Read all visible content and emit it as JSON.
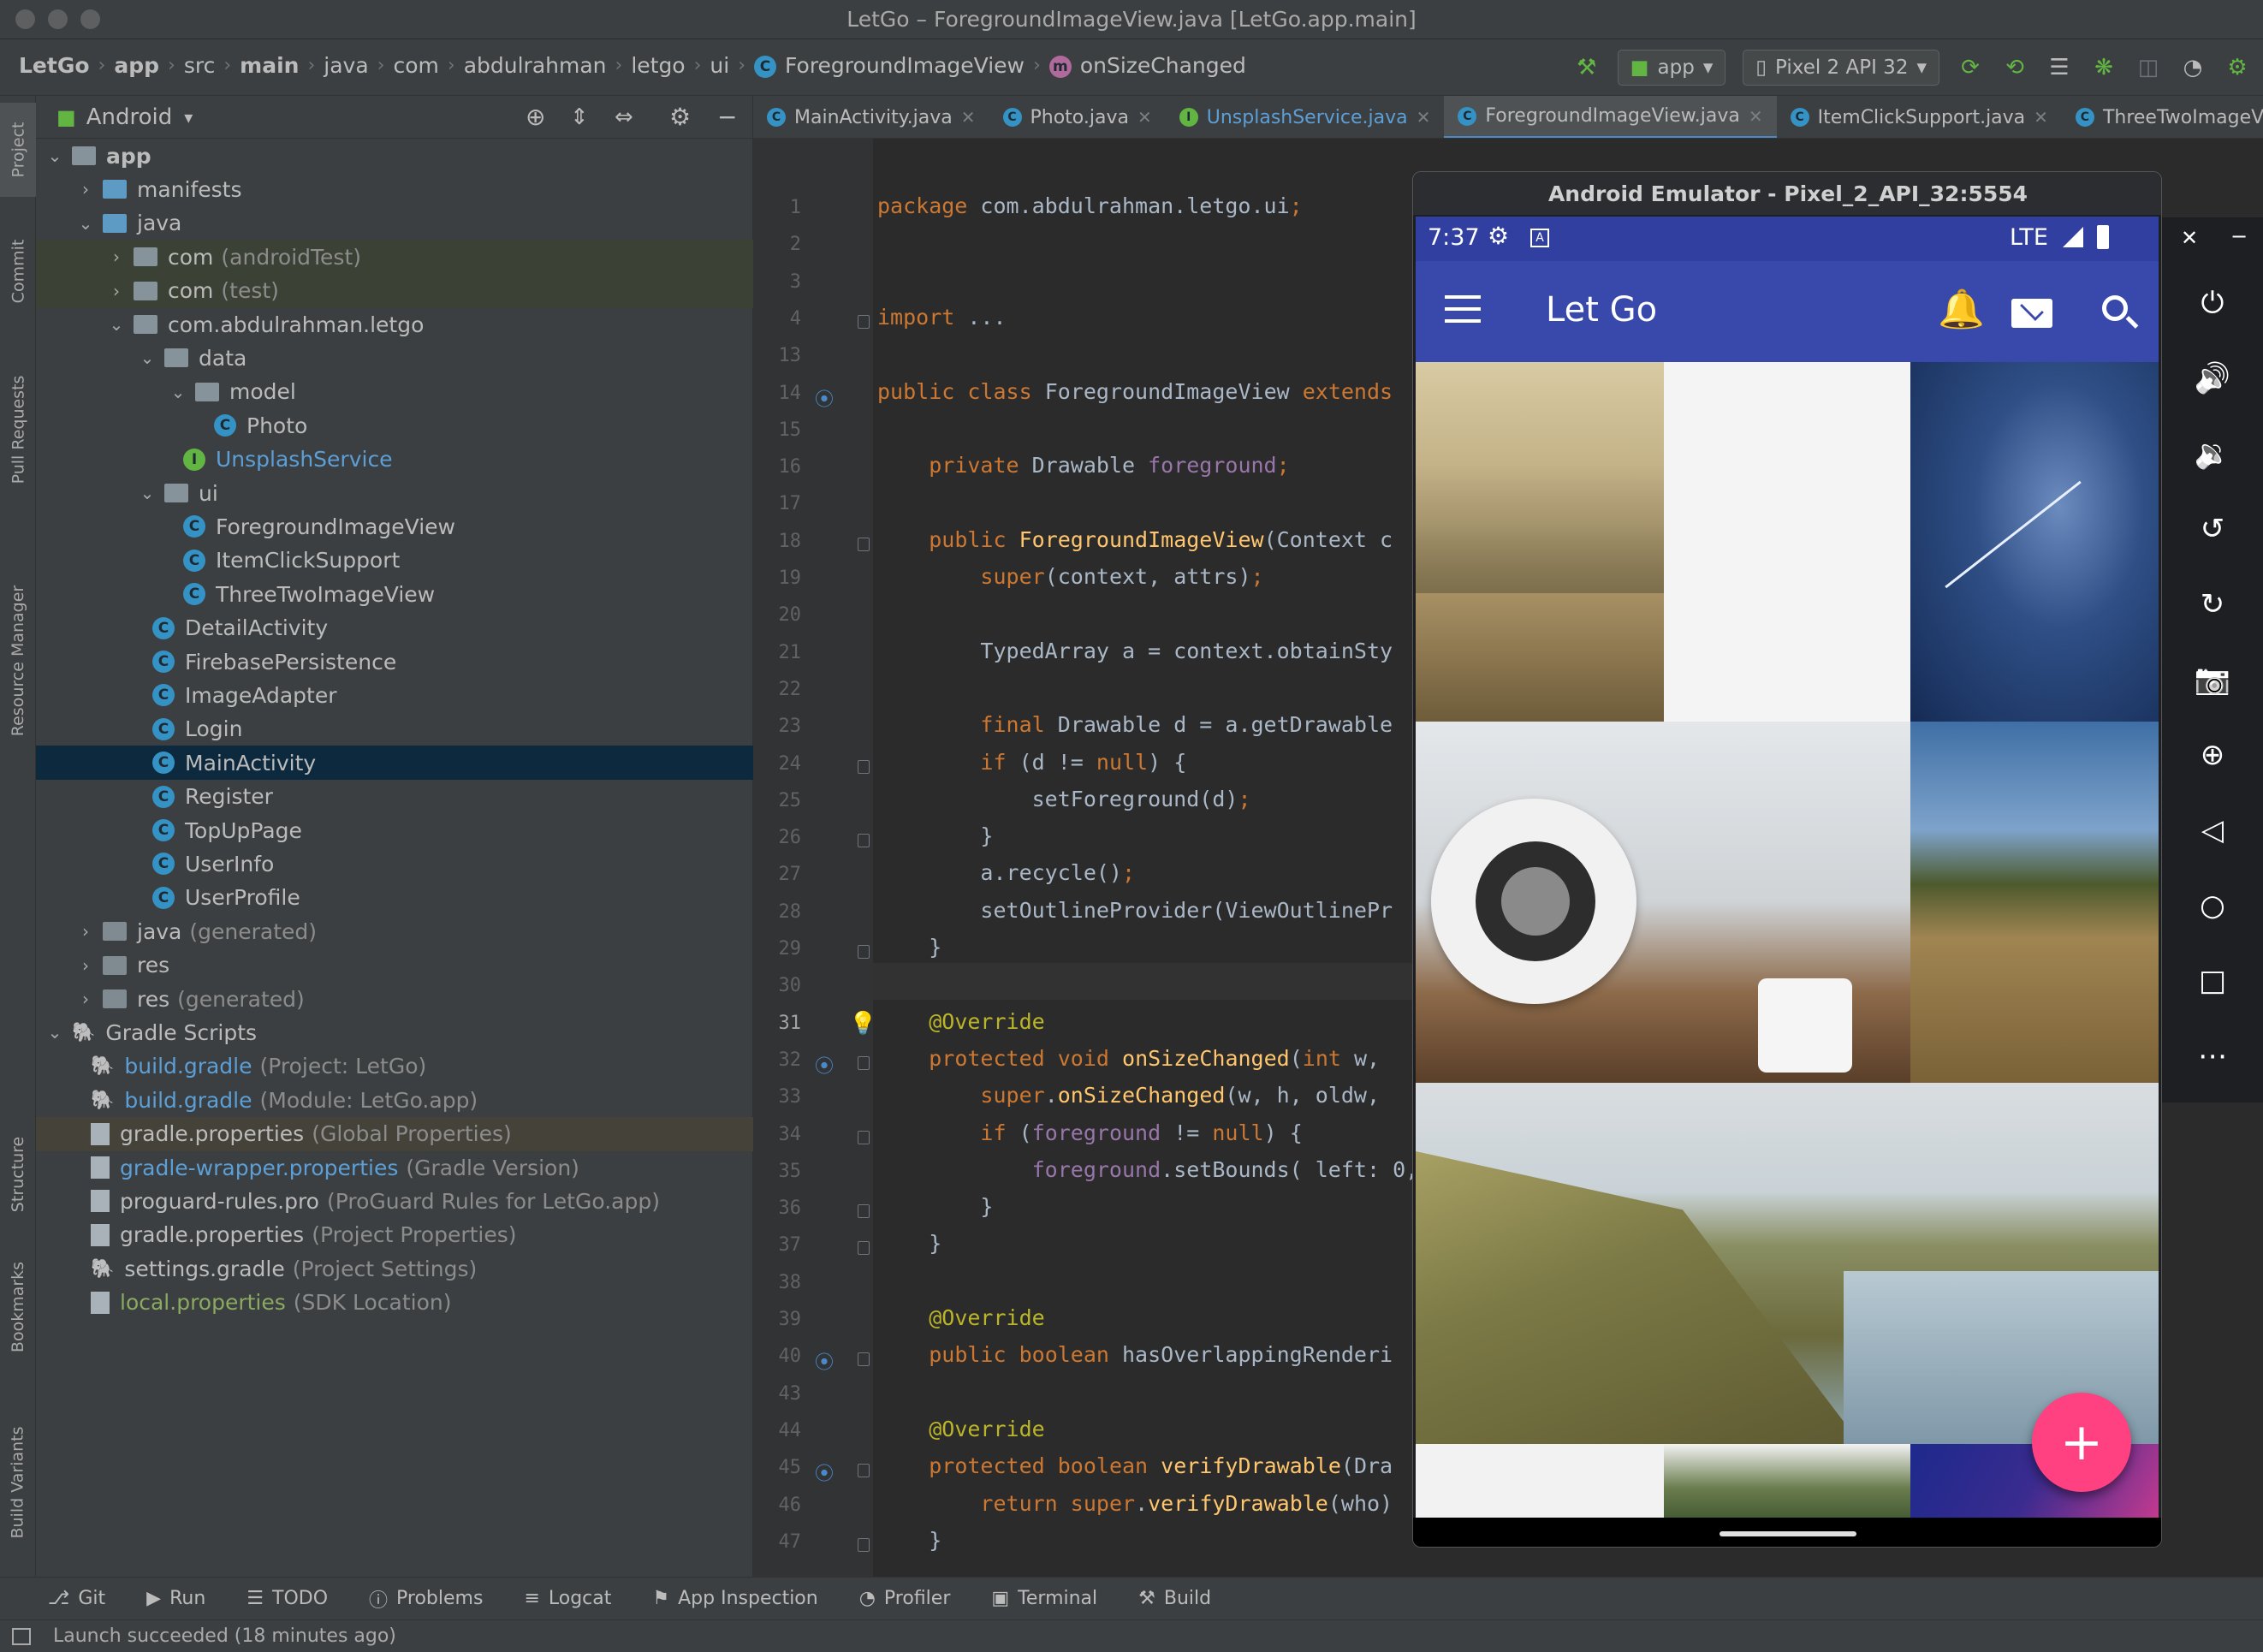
{
  "window": {
    "title": "LetGo – ForegroundImageView.java [LetGo.app.main]"
  },
  "breadcrumbs": [
    "LetGo",
    "app",
    "src",
    "main",
    "java",
    "com",
    "abdulrahman",
    "letgo",
    "ui",
    "ForegroundImageView",
    "onSizeChanged"
  ],
  "toolbar": {
    "run_config": "app",
    "device": "Pixel 2 API 32"
  },
  "left_tool_windows": [
    "Project",
    "Commit",
    "Pull Requests",
    "Resource Manager",
    "Structure",
    "Bookmarks",
    "Build Variants"
  ],
  "project_panel": {
    "view_mode": "Android",
    "tree": [
      {
        "label": "app",
        "extra": "",
        "depth": 0,
        "icon": "folder-app-icon",
        "expanded": true
      },
      {
        "label": "manifests",
        "extra": "",
        "depth": 1,
        "icon": "folder-icon",
        "expanded": false
      },
      {
        "label": "java",
        "extra": "",
        "depth": 1,
        "icon": "folder-icon",
        "expanded": true
      },
      {
        "label": "com",
        "extra": "(androidTest)",
        "depth": 2,
        "icon": "package-icon",
        "expanded": false
      },
      {
        "label": "com",
        "extra": "(test)",
        "depth": 2,
        "icon": "package-icon",
        "expanded": false
      },
      {
        "label": "com.abdulrahman.letgo",
        "extra": "",
        "depth": 2,
        "icon": "package-icon",
        "expanded": true
      },
      {
        "label": "data",
        "extra": "",
        "depth": 3,
        "icon": "package-icon",
        "expanded": true
      },
      {
        "label": "model",
        "extra": "",
        "depth": 4,
        "icon": "package-icon",
        "expanded": true
      },
      {
        "label": "Photo",
        "extra": "",
        "depth": 5,
        "icon": "class-icon"
      },
      {
        "label": "UnsplashService",
        "extra": "",
        "depth": 4,
        "icon": "interface-icon"
      },
      {
        "label": "ui",
        "extra": "",
        "depth": 3,
        "icon": "package-icon",
        "expanded": true
      },
      {
        "label": "ForegroundImageView",
        "extra": "",
        "depth": 4,
        "icon": "class-icon"
      },
      {
        "label": "ItemClickSupport",
        "extra": "",
        "depth": 4,
        "icon": "class-icon"
      },
      {
        "label": "ThreeTwoImageView",
        "extra": "",
        "depth": 4,
        "icon": "class-icon"
      },
      {
        "label": "DetailActivity",
        "extra": "",
        "depth": 3,
        "icon": "class-icon"
      },
      {
        "label": "FirebasePersistence",
        "extra": "",
        "depth": 3,
        "icon": "class-icon"
      },
      {
        "label": "ImageAdapter",
        "extra": "",
        "depth": 3,
        "icon": "class-icon"
      },
      {
        "label": "Login",
        "extra": "",
        "depth": 3,
        "icon": "class-icon"
      },
      {
        "label": "MainActivity",
        "extra": "",
        "depth": 3,
        "icon": "class-icon",
        "selected": true
      },
      {
        "label": "Register",
        "extra": "",
        "depth": 3,
        "icon": "class-icon"
      },
      {
        "label": "TopUpPage",
        "extra": "",
        "depth": 3,
        "icon": "class-icon"
      },
      {
        "label": "UserInfo",
        "extra": "",
        "depth": 3,
        "icon": "class-icon"
      },
      {
        "label": "UserProfile",
        "extra": "",
        "depth": 3,
        "icon": "class-icon"
      },
      {
        "label": "java",
        "extra": "(generated)",
        "depth": 1,
        "icon": "folder-generated-icon",
        "expanded": false
      },
      {
        "label": "res",
        "extra": "",
        "depth": 1,
        "icon": "folder-res-icon",
        "expanded": false
      },
      {
        "label": "res",
        "extra": "(generated)",
        "depth": 1,
        "icon": "folder-res-icon",
        "expanded": false
      },
      {
        "label": "Gradle Scripts",
        "extra": "",
        "depth": 0,
        "icon": "gradle-icon",
        "expanded": true
      },
      {
        "label": "build.gradle",
        "extra": "(Project: LetGo)",
        "depth": 1,
        "icon": "gradle-file-icon"
      },
      {
        "label": "build.gradle",
        "extra": "(Module: LetGo.app)",
        "depth": 1,
        "icon": "gradle-file-icon"
      },
      {
        "label": "gradle.properties",
        "extra": "(Global Properties)",
        "depth": 1,
        "icon": "properties-file-icon"
      },
      {
        "label": "gradle-wrapper.properties",
        "extra": "(Gradle Version)",
        "depth": 1,
        "icon": "properties-file-icon"
      },
      {
        "label": "proguard-rules.pro",
        "extra": "(ProGuard Rules for LetGo.app)",
        "depth": 1,
        "icon": "text-file-icon"
      },
      {
        "label": "gradle.properties",
        "extra": "(Project Properties)",
        "depth": 1,
        "icon": "properties-file-icon"
      },
      {
        "label": "settings.gradle",
        "extra": "(Project Settings)",
        "depth": 1,
        "icon": "gradle-file-icon"
      },
      {
        "label": "local.properties",
        "extra": "(SDK Location)",
        "depth": 1,
        "icon": "properties-file-icon"
      }
    ]
  },
  "editor_tabs": [
    {
      "label": "MainActivity.java",
      "icon": "class-icon"
    },
    {
      "label": "Photo.java",
      "icon": "class-icon"
    },
    {
      "label": "UnsplashService.java",
      "icon": "interface-icon"
    },
    {
      "label": "ForegroundImageView.java",
      "icon": "class-icon",
      "active": true
    },
    {
      "label": "ItemClickSupport.java",
      "icon": "class-icon"
    },
    {
      "label": "ThreeTwoImageView.j",
      "icon": "class-icon"
    }
  ],
  "code_lines": [
    {
      "n": "1",
      "text": "package com.abdulrahman.letgo.ui;"
    },
    {
      "n": "2",
      "text": ""
    },
    {
      "n": "3",
      "text": ""
    },
    {
      "n": "4",
      "text": "import ..."
    },
    {
      "n": "13",
      "text": ""
    },
    {
      "n": "14",
      "text": "public class ForegroundImageView extends"
    },
    {
      "n": "15",
      "text": ""
    },
    {
      "n": "16",
      "text": "    private Drawable foreground;"
    },
    {
      "n": "17",
      "text": ""
    },
    {
      "n": "18",
      "text": "    public ForegroundImageView(Context c"
    },
    {
      "n": "19",
      "text": "        super(context, attrs);"
    },
    {
      "n": "20",
      "text": ""
    },
    {
      "n": "21",
      "text": "        TypedArray a = context.obtainSty"
    },
    {
      "n": "22",
      "text": ""
    },
    {
      "n": "23",
      "text": "        final Drawable d = a.getDrawable"
    },
    {
      "n": "24",
      "text": "        if (d != null) {"
    },
    {
      "n": "25",
      "text": "            setForeground(d);"
    },
    {
      "n": "26",
      "text": "        }"
    },
    {
      "n": "27",
      "text": "        a.recycle();"
    },
    {
      "n": "28",
      "text": "        setOutlineProvider(ViewOutlinePr"
    },
    {
      "n": "29",
      "text": "    }"
    },
    {
      "n": "30",
      "text": ""
    },
    {
      "n": "31",
      "text": "    @Override"
    },
    {
      "n": "32",
      "text": "    protected void onSizeChanged(int w,"
    },
    {
      "n": "33",
      "text": "        super.onSizeChanged(w, h, oldw,"
    },
    {
      "n": "34",
      "text": "        if (foreground != null) {"
    },
    {
      "n": "35",
      "text": "            foreground.setBounds( left: 0,"
    },
    {
      "n": "36",
      "text": "        }"
    },
    {
      "n": "37",
      "text": "    }"
    },
    {
      "n": "38",
      "text": ""
    },
    {
      "n": "39",
      "text": "    @Override"
    },
    {
      "n": "40",
      "text": "    public boolean hasOverlappingRenderi"
    },
    {
      "n": "43",
      "text": ""
    },
    {
      "n": "44",
      "text": "    @Override"
    },
    {
      "n": "45",
      "text": "    protected boolean verifyDrawable(Dra"
    },
    {
      "n": "46",
      "text": "        return super.verifyDrawable(who)"
    },
    {
      "n": "47",
      "text": "    }"
    }
  ],
  "emulator": {
    "title": "Android Emulator - Pixel_2_API_32:5554",
    "status_time": "7:37",
    "network": "LTE",
    "app_title": "Let Go",
    "side_controls": [
      "power-icon",
      "volume-up-icon",
      "volume-down-icon",
      "rotate-left-icon",
      "rotate-right-icon",
      "camera-icon",
      "zoom-icon",
      "back-icon",
      "home-icon",
      "overview-icon",
      "more-icon"
    ]
  },
  "bottom_tools": [
    "Git",
    "Run",
    "TODO",
    "Problems",
    "Logcat",
    "App Inspection",
    "Profiler",
    "Terminal",
    "Build"
  ],
  "status_message": "Launch succeeded (18 minutes ago)",
  "colors": {
    "accent": "#3949ab",
    "fab": "#ff4081",
    "selection": "#0d293e"
  }
}
